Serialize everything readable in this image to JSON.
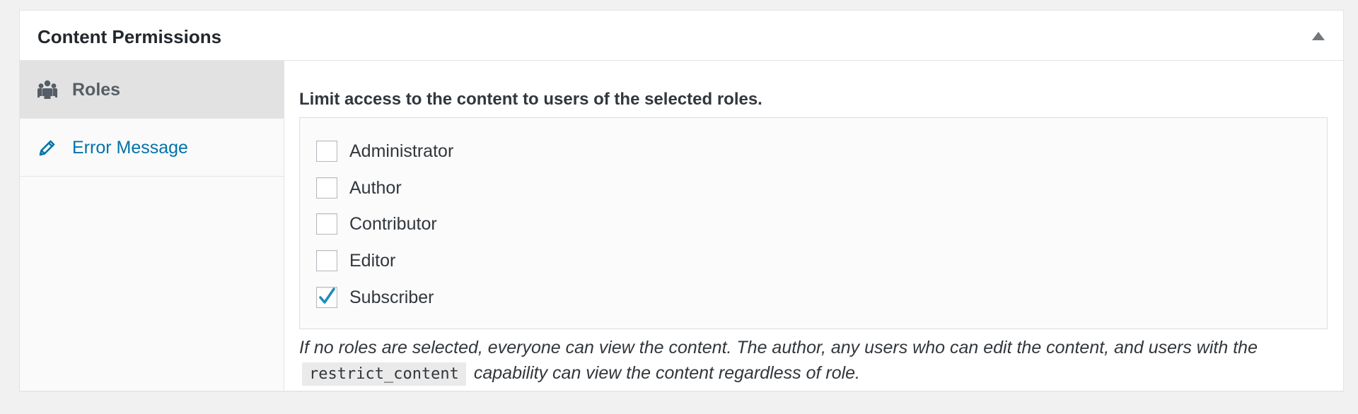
{
  "postbox": {
    "title": "Content Permissions"
  },
  "tabs": [
    {
      "label": "Roles",
      "icon": "groups-icon",
      "active": true
    },
    {
      "label": "Error Message",
      "icon": "edit-icon",
      "active": false
    }
  ],
  "roles_panel": {
    "heading": "Limit access to the content to users of the selected roles.",
    "roles": [
      {
        "label": "Administrator",
        "checked": false
      },
      {
        "label": "Author",
        "checked": false
      },
      {
        "label": "Contributor",
        "checked": false
      },
      {
        "label": "Editor",
        "checked": false
      },
      {
        "label": "Subscriber",
        "checked": true
      }
    ],
    "description_before": "If no roles are selected, everyone can view the content. The author, any users who can edit the content, and users with the",
    "description_code": "restrict_content",
    "description_after": "capability can view the content regardless of role."
  },
  "colors": {
    "link": "#0073aa",
    "check": "#1e8cbe",
    "active_tab_bg": "#e2e2e2"
  }
}
